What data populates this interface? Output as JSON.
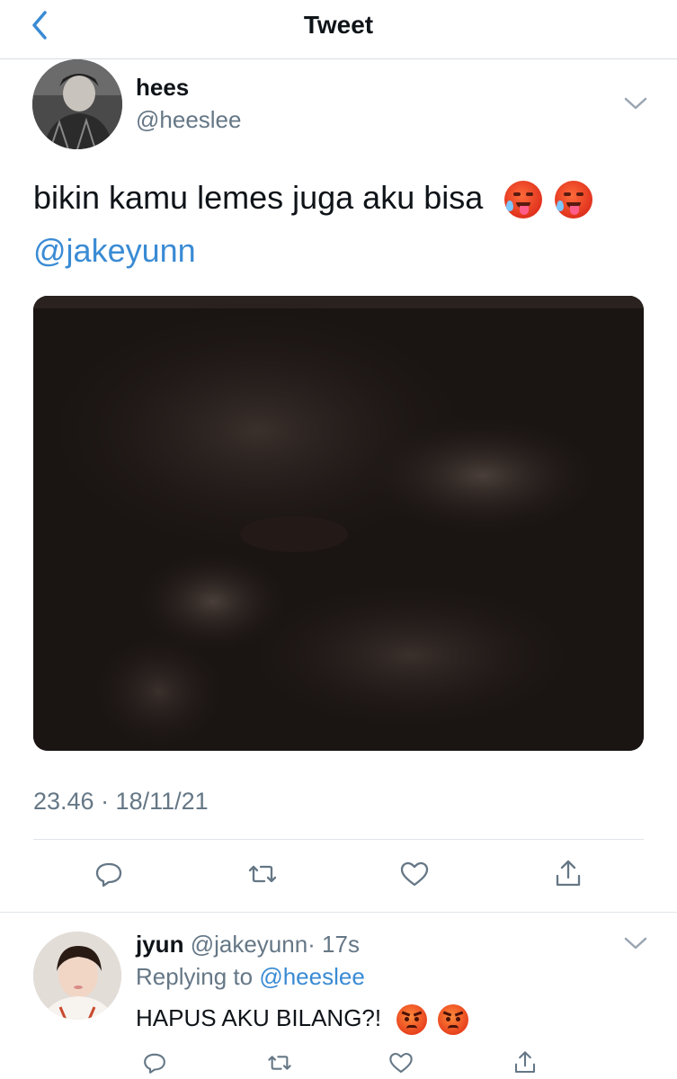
{
  "header": {
    "title": "Tweet"
  },
  "tweet": {
    "author_name": "hees",
    "author_handle": "@heeslee",
    "text": "bikin kamu lemes juga aku bisa",
    "emojis": [
      "hot-face-emoji",
      "hot-face-emoji"
    ],
    "mention": "@jakeyunn",
    "timestamp": "23.46 · 18/11/21"
  },
  "reply": {
    "author_name": "jyun",
    "author_handle": "@jakeyunn",
    "time": "· 17s",
    "replying_prefix": "Replying to",
    "replying_to": "@heeslee",
    "text": "HAPUS AKU BILANG?!",
    "emojis": [
      "angry-face-emoji",
      "angry-face-emoji"
    ]
  },
  "icons": [
    "back-chevron-icon",
    "chevron-down-icon",
    "reply-icon",
    "retweet-icon",
    "like-icon",
    "share-icon"
  ],
  "colors": {
    "accent": "#3a8bd4",
    "muted": "#657786",
    "divider": "#e1e6ea"
  }
}
